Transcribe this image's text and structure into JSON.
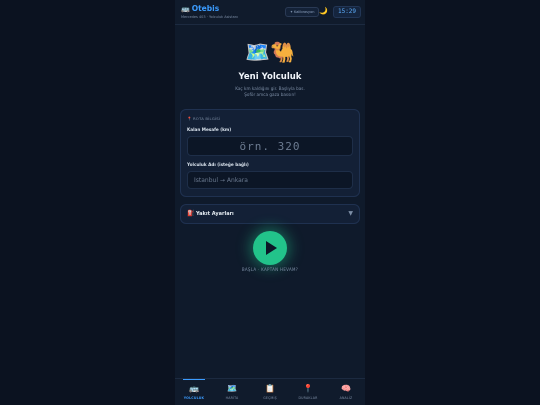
{
  "header": {
    "brand_icon": "🚌",
    "brand": "Otebis",
    "subtitle": "Mercedes 403 · Yolculuk Asistanı",
    "lang_button": "✦ Kalibrasyon",
    "theme_icon": "🌙",
    "clock": "15:29"
  },
  "hero": {
    "icons": "🗺️🐫",
    "title": "Yeni Yolculuk",
    "subtitle_line1": "Kaç km kaldığını gir. Başlıyla bas.",
    "subtitle_line2": "Şoför amca gaza bassın!"
  },
  "route": {
    "section_icon": "📍",
    "section_title": "ROTA BİLGİSİ",
    "distance_label": "Kalan Mesafe (km)",
    "distance_placeholder": "örn. 320",
    "distance_value": "",
    "name_label": "Yolculuk Adı (isteğe bağlı)",
    "name_placeholder": "İstanbul → Ankara",
    "name_value": ""
  },
  "fuel": {
    "icon": "⛽",
    "label": "Yakıt Ayarları",
    "chevron": "▼"
  },
  "start": {
    "caption": "BAŞLA · KAPTAN HEVAM?"
  },
  "nav": [
    {
      "icon": "🚌",
      "label": "YOLCULUK",
      "active": true
    },
    {
      "icon": "🗺️",
      "label": "HARİTA",
      "active": false
    },
    {
      "icon": "📋",
      "label": "GEÇMİŞ",
      "active": false
    },
    {
      "icon": "📍",
      "label": "DURAKLAR",
      "active": false
    },
    {
      "icon": "🧠",
      "label": "ANALİZ",
      "active": false
    }
  ],
  "colors": {
    "accent": "#3b9cff",
    "start_button": "#22c38a",
    "background": "#0b1220"
  }
}
